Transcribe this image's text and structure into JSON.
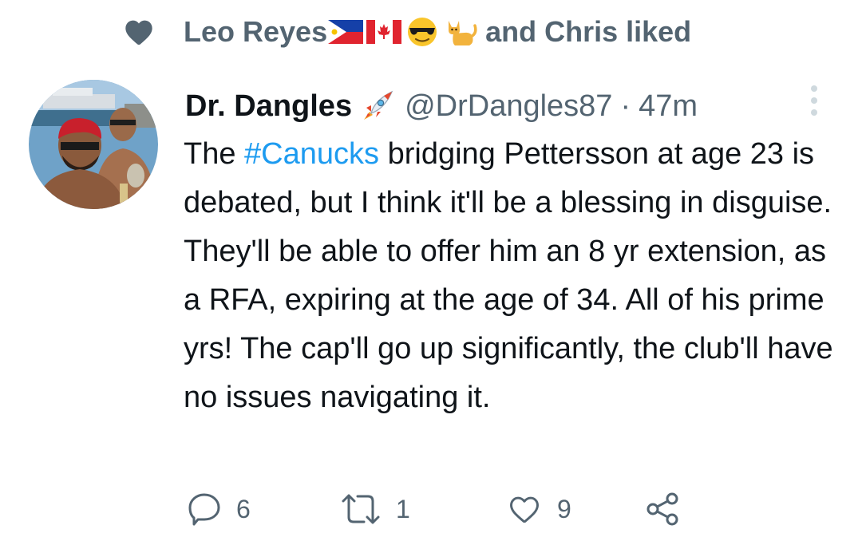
{
  "social_context": {
    "liker_name": "Leo Reyes",
    "emojis": [
      "philippines-flag",
      "canada-flag",
      "sunglasses-face",
      "cat"
    ],
    "suffix": "and Chris liked"
  },
  "author": {
    "display_name": "Dr. Dangles",
    "name_emoji": "rocket",
    "handle": "@DrDangles87",
    "separator": "·",
    "time": "47m"
  },
  "tweet": {
    "text_before": "The ",
    "hashtag": "#Canucks",
    "text_after": " bridging Pettersson at age 23 is debated, but I think it'll be a blessing in disguise. They'll be able to offer him an 8 yr extension, as a RFA, expiring at the age of 34. All of his prime yrs! The cap'll go up significantly, the club'll have no issues navigating it."
  },
  "actions": {
    "replies": "6",
    "retweets": "1",
    "likes": "9"
  },
  "colors": {
    "text": "#0f1419",
    "secondary": "#536471",
    "link": "#1d9bf0"
  }
}
